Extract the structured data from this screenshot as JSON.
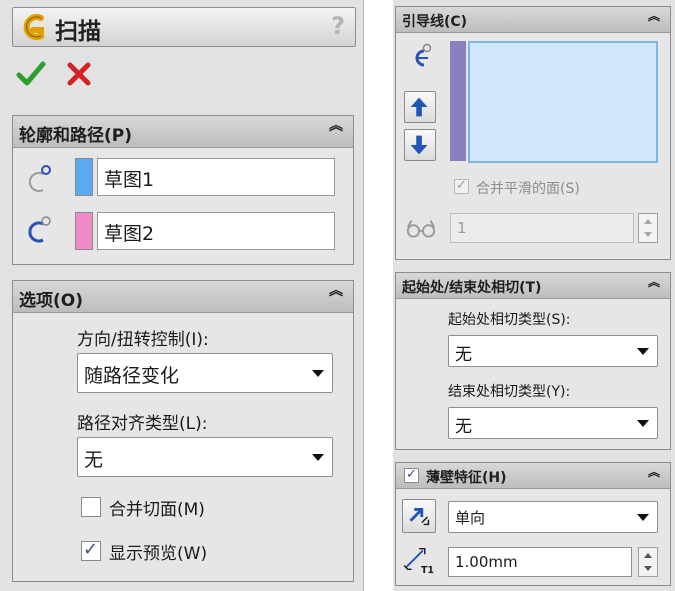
{
  "feature": {
    "title": "扫描",
    "help": "?"
  },
  "profile_path": {
    "header": "轮廓和路径(P)",
    "profile_value": "草图1",
    "path_value": "草图2",
    "profile_color": "#5ba9f0",
    "path_color": "#ef8cc8"
  },
  "options": {
    "header": "选项(O)",
    "orientation_label": "方向/扭转控制(I):",
    "orientation_value": "随路径变化",
    "alignment_label": "路径对齐类型(L):",
    "alignment_value": "无",
    "merge_tangent_label": "合并切面(M)",
    "merge_tangent_checked": false,
    "show_preview_label": "显示预览(W)",
    "show_preview_checked": true
  },
  "guide_curves": {
    "header": "引导线(C)",
    "merge_smooth_label": "合并平滑的面(S)",
    "merge_smooth_checked": true,
    "count_value": "1"
  },
  "tangency": {
    "header": "起始处/结束处相切(T)",
    "start_label": "起始处相切类型(S):",
    "start_value": "无",
    "end_label": "结束处相切类型(Y):",
    "end_value": "无"
  },
  "thin_feature": {
    "header": "薄壁特征(H)",
    "enabled": true,
    "direction_value": "单向",
    "thickness_value": "1.00mm"
  },
  "colors": {
    "accent_purple": "#8a7fc0",
    "listbox_fill": "#cfe6fb",
    "ok_green": "#2e9e2e",
    "cancel_red": "#d42020"
  }
}
